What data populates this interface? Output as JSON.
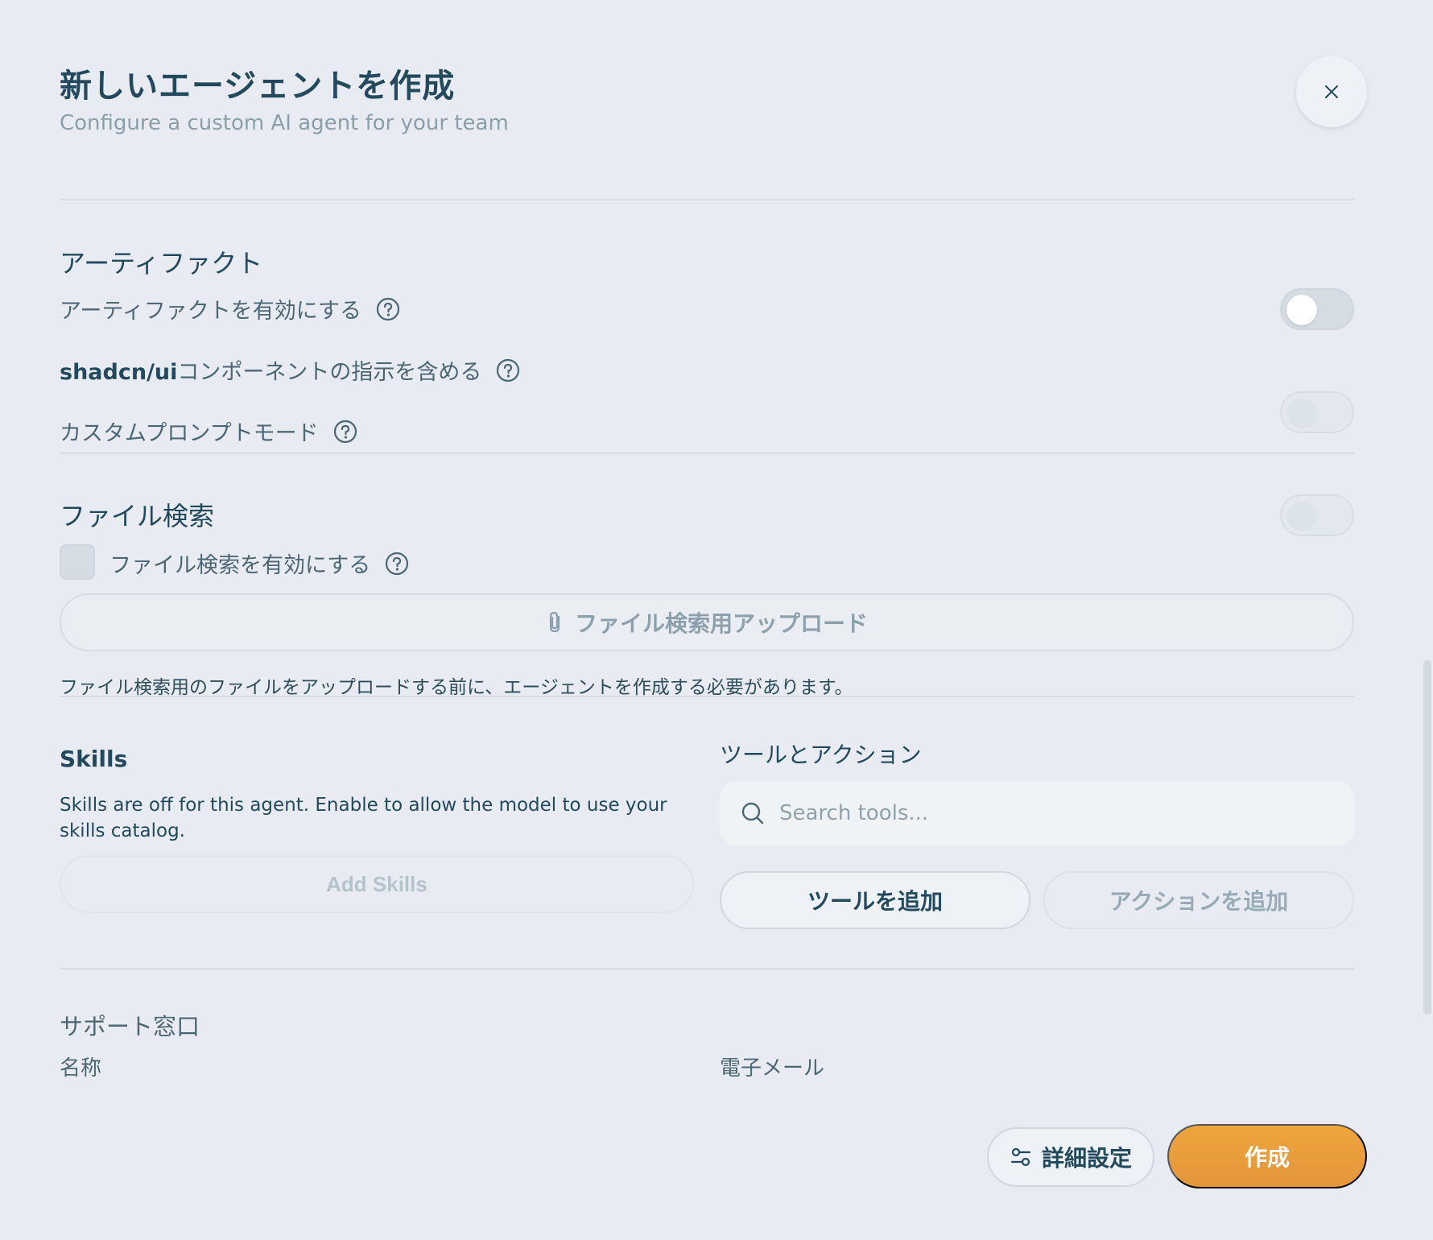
{
  "header": {
    "title": "新しいエージェントを作成",
    "subtitle": "Configure a custom AI agent for your team",
    "close_icon": "close-icon"
  },
  "artifacts": {
    "heading": "アーティファクト",
    "rows": [
      {
        "label": "アーティファクトを有効にする",
        "enabled": false,
        "disabled": false
      },
      {
        "label_bold": "shadcn/ui",
        "label": "コンポーネントの指示を含める",
        "enabled": false,
        "disabled": true
      },
      {
        "label": "カスタムプロンプトモード",
        "enabled": false,
        "disabled": true
      }
    ]
  },
  "file_search": {
    "heading": "ファイル検索",
    "checkbox_label": "ファイル検索を有効にする",
    "upload_label": "ファイル検索用アップロード",
    "upload_icon": "paperclip-icon",
    "notice": "ファイル検索用のファイルをアップロードする前に、エージェントを作成する必要があります。"
  },
  "skills": {
    "title": "Skills",
    "enabled": false,
    "description": "Skills are off for this agent. Enable to allow the model to use your skills catalog.",
    "add_label": "Add Skills"
  },
  "tools": {
    "title": "ツールとアクション",
    "search_placeholder": "Search tools...",
    "add_tools_label": "ツールを追加",
    "add_actions_label": "アクションを追加"
  },
  "support": {
    "heading": "サポート窓口",
    "name_label": "名称",
    "email_label": "電子メール"
  },
  "footer": {
    "advanced_label": "詳細設定",
    "create_label": "作成"
  },
  "colors": {
    "background": "#e8ecf2",
    "primary_text": "#234a5c",
    "accent": "#eea53d"
  }
}
